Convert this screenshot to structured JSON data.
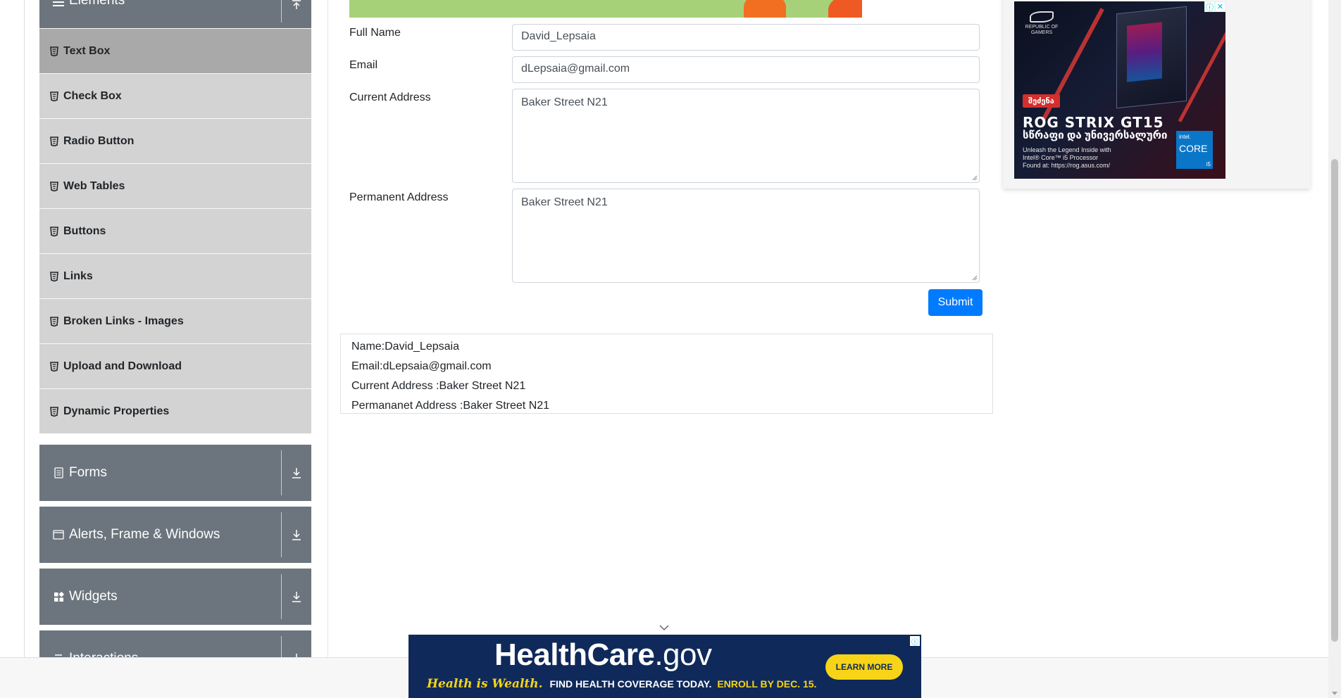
{
  "sidebar": {
    "elements_group": {
      "label": "Elements"
    },
    "items": [
      {
        "label": "Text Box",
        "active": true
      },
      {
        "label": "Check Box"
      },
      {
        "label": "Radio Button"
      },
      {
        "label": "Web Tables"
      },
      {
        "label": "Buttons"
      },
      {
        "label": "Links"
      },
      {
        "label": "Broken Links - Images"
      },
      {
        "label": "Upload and Download"
      },
      {
        "label": "Dynamic Properties"
      }
    ],
    "groups": [
      {
        "label": "Forms",
        "icon": "document-icon"
      },
      {
        "label": "Alerts, Frame & Windows",
        "icon": "window-icon"
      },
      {
        "label": "Widgets",
        "icon": "widgets-icon"
      },
      {
        "label": "Interactions",
        "icon": "interactions-icon"
      }
    ]
  },
  "form": {
    "full_name": {
      "label": "Full Name",
      "value": "David_Lepsaia"
    },
    "email": {
      "label": "Email",
      "value": "dLepsaia@gmail.com"
    },
    "current_address": {
      "label": "Current Address",
      "value": "Baker Street N21"
    },
    "permanent_address": {
      "label": "Permanent Address",
      "value": "Baker Street N21"
    },
    "submit_label": "Submit"
  },
  "output": {
    "name": "Name:David_Lepsaia",
    "email": "Email:dLepsaia@gmail.com",
    "current_address": "Current Address :Baker Street N21",
    "permanent_address": "Permananet Address :Baker Street N21"
  },
  "ads": {
    "right": {
      "cta": "შეძენა",
      "title": "ROG STRIX GT15",
      "subtitle": "სწრაფი და უნივერსალური",
      "line1": "Unleash the Legend Inside with",
      "line2": "Intel® Core™ i5 Processor",
      "line3": "Found at: https://rog.asus.com/",
      "logo_top": "REPUBLIC OF",
      "logo_bottom": "GAMERS",
      "intel_brand": "intel.",
      "intel_core": "CORE",
      "intel_tier": "i5"
    },
    "bottom": {
      "logo_main": "HealthCare",
      "logo_suffix": ".gov",
      "tag_wealth": "Health is Wealth.",
      "tag_find": "FIND HEALTH COVERAGE TODAY.",
      "tag_enroll": "ENROLL BY DEC. 15.",
      "button": "LEARN MORE"
    }
  },
  "colors": {
    "primary": "#007bff",
    "sidebar_group": "#6c757d",
    "sidebar_item": "#d3d3d3",
    "sidebar_item_active": "#a9a9a9"
  }
}
